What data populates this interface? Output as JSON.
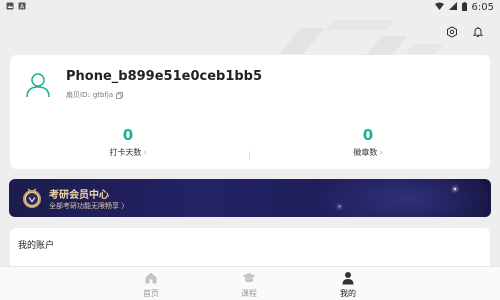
{
  "status_bar": {
    "time": "6:05",
    "left_icons": [
      "image-icon",
      "text-icon"
    ],
    "right_icons": [
      "wifi-icon",
      "signal-icon",
      "battery-icon"
    ]
  },
  "header": {
    "icons": [
      "settings-icon",
      "bell-icon"
    ]
  },
  "profile": {
    "username": "Phone_b899e51e0ceb1bb5",
    "uid_label": "扇贝ID:",
    "uid_value": "gtbfja",
    "stats": [
      {
        "value": "0",
        "label": "打卡天数"
      },
      {
        "value": "0",
        "label": "徽章数"
      }
    ]
  },
  "vip_banner": {
    "title": "考研会员中心",
    "subtitle": "全部考研功能无限畅享 〉"
  },
  "account": {
    "title": "我的账户"
  },
  "bottom_nav": {
    "items": [
      {
        "label": "首页",
        "icon": "home-icon",
        "active": false
      },
      {
        "label": "课程",
        "icon": "graduation-cap-icon",
        "active": false
      },
      {
        "label": "我的",
        "icon": "person-icon",
        "active": true
      }
    ]
  },
  "colors": {
    "accent": "#1ab394",
    "vip_gold": "#f2d7a6",
    "vip_bg": "#1d1c4d"
  }
}
